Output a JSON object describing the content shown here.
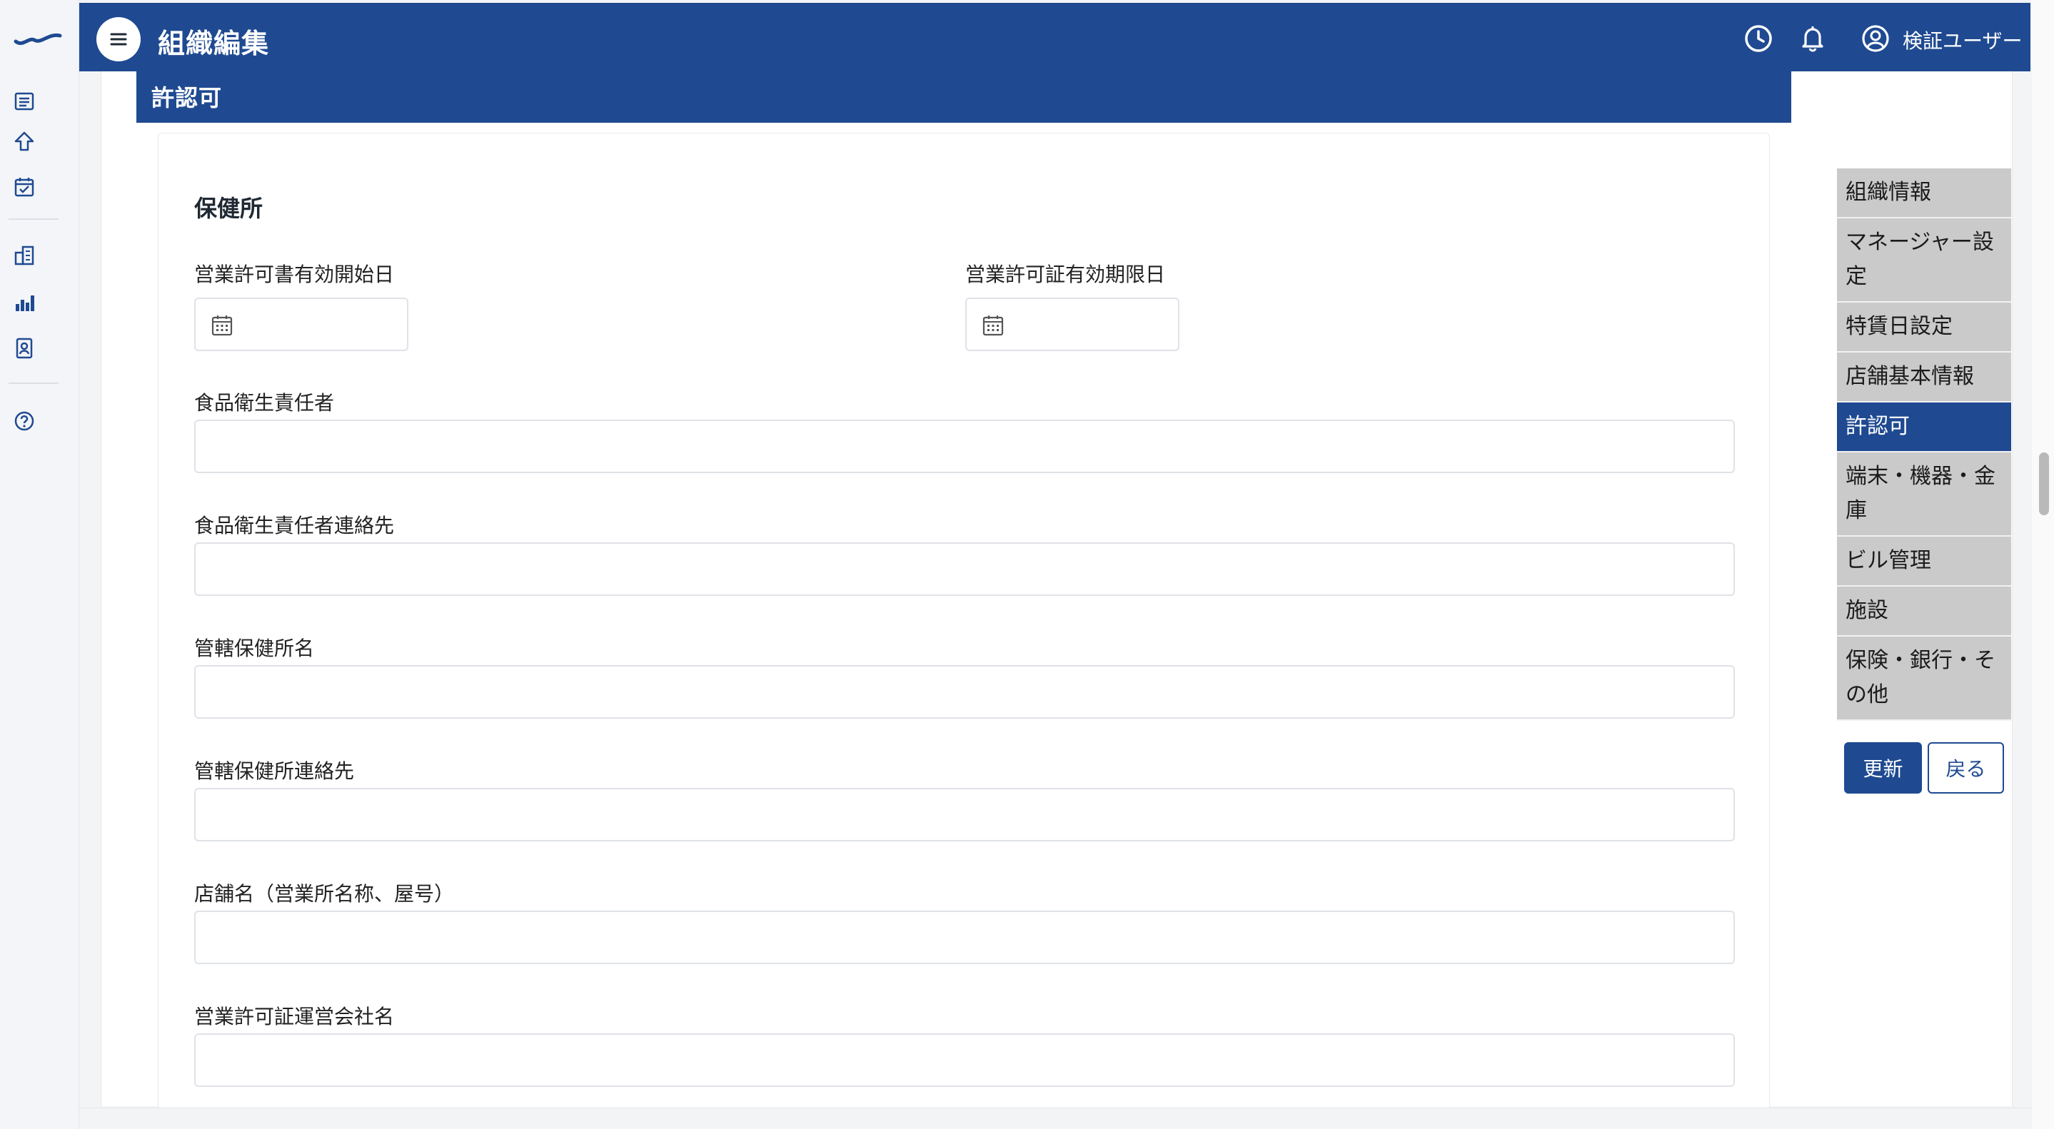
{
  "header": {
    "title": "組織編集",
    "user_name": "検証ユーザー"
  },
  "section": {
    "title": "許認可",
    "card_title": "保健所"
  },
  "form": {
    "start_date_label": "営業許可書有効開始日",
    "end_date_label": "営業許可証有効期限日",
    "food_manager_label": "食品衛生責任者",
    "food_manager_contact_label": "食品衛生責任者連絡先",
    "health_center_name_label": "管轄保健所名",
    "health_center_contact_label": "管轄保健所連絡先",
    "store_name_label": "店舗名（営業所名称、屋号）",
    "operating_company_label": "営業許可証運営会社名"
  },
  "side_nav": {
    "items": [
      "組織情報",
      "マネージャー設定",
      "特賃日設定",
      "店舗基本情報",
      "許認可",
      "端末・機器・金庫",
      "ビル管理",
      "施設",
      "保険・銀行・その他"
    ],
    "active_index": 4,
    "update_label": "更新",
    "back_label": "戻る"
  },
  "icons": {
    "rail": [
      "logo-wave-icon",
      "list-icon",
      "upload-icon",
      "calendar-check-icon",
      "building-icon",
      "bar-chart-icon",
      "id-badge-icon",
      "help-icon"
    ],
    "header": [
      "menu-icon",
      "clock-icon",
      "bell-icon",
      "user-circle-icon"
    ],
    "date_inputs": "calendar-icon"
  },
  "colors": {
    "primary": "#1f4a91",
    "nav_inactive": "#cacaca"
  }
}
